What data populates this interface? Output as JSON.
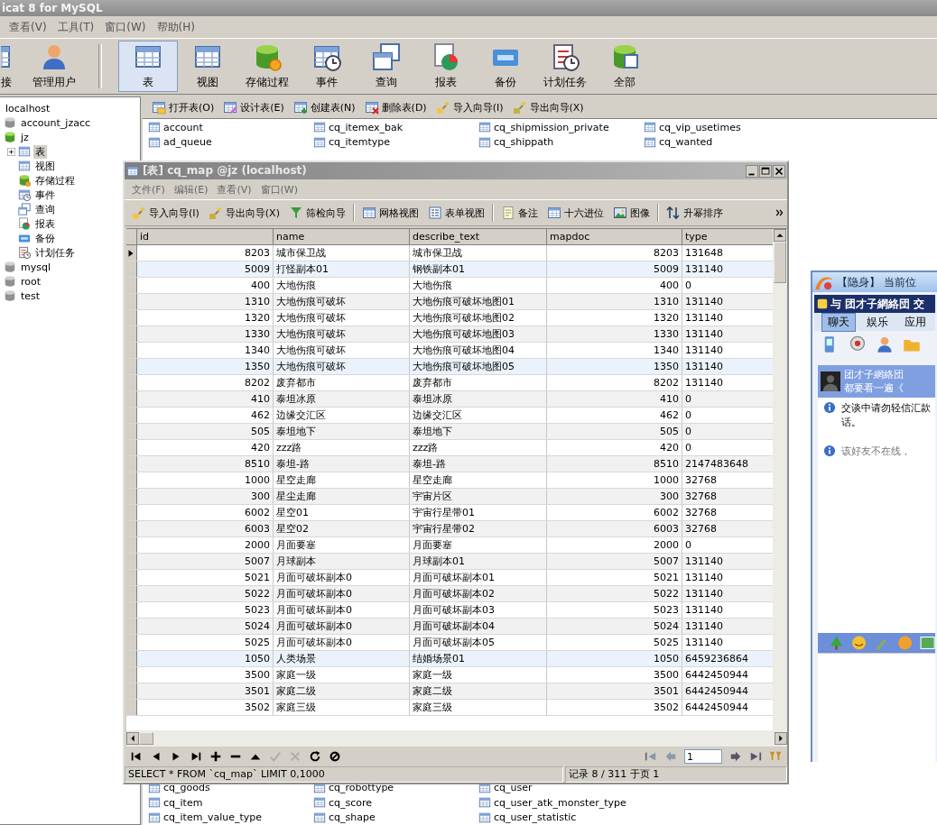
{
  "main_window": {
    "title": "icat 8 for MySQL",
    "menu": [
      "查看(V)",
      "工具(T)",
      "窗口(W)",
      "帮助(H)"
    ],
    "toolbar": [
      {
        "label": "接",
        "selected": false
      },
      {
        "label": "管理用户",
        "selected": false
      },
      {
        "label": "表",
        "selected": true
      },
      {
        "label": "视图",
        "selected": false
      },
      {
        "label": "存储过程",
        "selected": false
      },
      {
        "label": "事件",
        "selected": false
      },
      {
        "label": "查询",
        "selected": false
      },
      {
        "label": "报表",
        "selected": false
      },
      {
        "label": "备份",
        "selected": false
      },
      {
        "label": "计划任务",
        "selected": false
      },
      {
        "label": "全部",
        "selected": false
      }
    ],
    "tree": [
      {
        "label": "localhost",
        "selected": false,
        "children": [
          {
            "label": "account_jzacc",
            "kind": "database",
            "open": false,
            "selected": false
          },
          {
            "label": "jz",
            "kind": "database",
            "open": true,
            "selected": false,
            "children": [
              {
                "label": "表",
                "kind": "table",
                "expanded": false,
                "selected": true
              },
              {
                "label": "视图",
                "kind": "view",
                "selected": false
              },
              {
                "label": "存储过程",
                "kind": "procedure",
                "selected": false
              },
              {
                "label": "事件",
                "kind": "event",
                "selected": false
              },
              {
                "label": "查询",
                "kind": "query",
                "selected": false
              },
              {
                "label": "报表",
                "kind": "report",
                "selected": false
              },
              {
                "label": "备份",
                "kind": "backup",
                "selected": false
              },
              {
                "label": "计划任务",
                "kind": "schedule",
                "selected": false
              }
            ]
          },
          {
            "label": "mysql",
            "kind": "database",
            "open": false,
            "selected": false
          },
          {
            "label": "root",
            "kind": "database",
            "open": false,
            "selected": false
          },
          {
            "label": "test",
            "kind": "database",
            "open": false,
            "selected": false
          }
        ]
      }
    ],
    "object_toolbar": [
      "打开表(O)",
      "设计表(E)",
      "创建表(N)",
      "删除表(D)",
      "导入向导(I)",
      "导出向导(X)"
    ],
    "table_list": {
      "rows_above": [
        [
          "account",
          "cq_itemex_bak",
          "cq_shipmission_private",
          "cq_vip_usetimes"
        ],
        [
          "ad_queue",
          "cq_itemtype",
          "cq_shippath",
          "cq_wanted"
        ]
      ],
      "rows_below": [
        [
          "cq_goods",
          "cq_robottype",
          "cq_user"
        ],
        [
          "cq_item",
          "cq_score",
          "cq_user_atk_monster_type"
        ],
        [
          "cq_item_value_type",
          "cq_shape",
          "cq_user_statistic"
        ]
      ]
    }
  },
  "table_window": {
    "title": "[表] cq_map @jz (localhost)",
    "menu": [
      "文件(F)",
      "编辑(E)",
      "查看(V)",
      "窗口(W)"
    ],
    "toolbar_groups": [
      [
        "导入向导(I)",
        "导出向导(X)",
        "筛检向导"
      ],
      [
        "网格视图",
        "表单视图"
      ],
      [
        "备注",
        "十六进位",
        "图像"
      ],
      [
        "升幂排序"
      ]
    ],
    "columns": [
      "id",
      "name",
      "describe_text",
      "mapdoc",
      "type"
    ],
    "rows": [
      {
        "cells": [
          "8203",
          "城市保卫战",
          "城市保卫战",
          "8203",
          "131648"
        ],
        "current": true,
        "selected": false
      },
      {
        "cells": [
          "5009",
          "打怪副本01",
          "钢铁副本01",
          "5009",
          "131140"
        ],
        "current": false,
        "selected": true
      },
      {
        "cells": [
          "400",
          "大地伤痕",
          "大地伤痕",
          "400",
          "0"
        ],
        "current": false,
        "selected": false
      },
      {
        "cells": [
          "1310",
          "大地伤痕可破坏",
          "大地伤痕可破坏地图01",
          "1310",
          "131140"
        ],
        "current": false,
        "selected": false
      },
      {
        "cells": [
          "1320",
          "大地伤痕可破坏",
          "大地伤痕可破坏地图02",
          "1320",
          "131140"
        ],
        "current": false,
        "selected": false
      },
      {
        "cells": [
          "1330",
          "大地伤痕可破坏",
          "大地伤痕可破坏地图03",
          "1330",
          "131140"
        ],
        "current": false,
        "selected": false
      },
      {
        "cells": [
          "1340",
          "大地伤痕可破坏",
          "大地伤痕可破坏地图04",
          "1340",
          "131140"
        ],
        "current": false,
        "selected": false
      },
      {
        "cells": [
          "1350",
          "大地伤痕可破坏",
          "大地伤痕可破坏地图05",
          "1350",
          "131140"
        ],
        "current": false,
        "selected": true
      },
      {
        "cells": [
          "8202",
          "废弃都市",
          "废弃都市",
          "8202",
          "131140"
        ],
        "current": false,
        "selected": false
      },
      {
        "cells": [
          "410",
          "泰坦冰原",
          "泰坦冰原",
          "410",
          "0"
        ],
        "current": false,
        "selected": false
      },
      {
        "cells": [
          "462",
          "边缘交汇区",
          "边缘交汇区",
          "462",
          "0"
        ],
        "current": false,
        "selected": false
      },
      {
        "cells": [
          "505",
          "泰坦地下",
          "泰坦地下",
          "505",
          "0"
        ],
        "current": false,
        "selected": false
      },
      {
        "cells": [
          "420",
          "zzz路",
          "zzz路",
          "420",
          "0"
        ],
        "current": false,
        "selected": false
      },
      {
        "cells": [
          "8510",
          "泰坦-路",
          "泰坦-路",
          "8510",
          "2147483648"
        ],
        "current": false,
        "selected": false
      },
      {
        "cells": [
          "1000",
          "星空走廊",
          "星空走廊",
          "1000",
          "32768"
        ],
        "current": false,
        "selected": false
      },
      {
        "cells": [
          "300",
          "星尘走廊",
          "宇宙片区",
          "300",
          "32768"
        ],
        "current": false,
        "selected": false
      },
      {
        "cells": [
          "6002",
          "星空01",
          "宇宙行星带01",
          "6002",
          "32768"
        ],
        "current": false,
        "selected": false
      },
      {
        "cells": [
          "6003",
          "星空02",
          "宇宙行星带02",
          "6003",
          "32768"
        ],
        "current": false,
        "selected": false
      },
      {
        "cells": [
          "2000",
          "月面要塞",
          "月面要塞",
          "2000",
          "0"
        ],
        "current": false,
        "selected": false
      },
      {
        "cells": [
          "5007",
          "月球副本",
          "月球副本01",
          "5007",
          "131140"
        ],
        "current": false,
        "selected": false
      },
      {
        "cells": [
          "5021",
          "月面可破坏副本0",
          "月面可破坏副本01",
          "5021",
          "131140"
        ],
        "current": false,
        "selected": false
      },
      {
        "cells": [
          "5022",
          "月面可破坏副本0",
          "月面可破坏副本02",
          "5022",
          "131140"
        ],
        "current": false,
        "selected": false
      },
      {
        "cells": [
          "5023",
          "月面可破坏副本0",
          "月面可破坏副本03",
          "5023",
          "131140"
        ],
        "current": false,
        "selected": false
      },
      {
        "cells": [
          "5024",
          "月面可破坏副本0",
          "月面可破坏副本04",
          "5024",
          "131140"
        ],
        "current": false,
        "selected": false
      },
      {
        "cells": [
          "5025",
          "月面可破坏副本0",
          "月面可破坏副本05",
          "5025",
          "131140"
        ],
        "current": false,
        "selected": false
      },
      {
        "cells": [
          "1050",
          "人类场景",
          "结婚场景01",
          "1050",
          "6459236864"
        ],
        "current": false,
        "selected": true
      },
      {
        "cells": [
          "3500",
          "家庭一级",
          "家庭一级",
          "3500",
          "6442450944"
        ],
        "current": false,
        "selected": false
      },
      {
        "cells": [
          "3501",
          "家庭二级",
          "家庭二级",
          "3501",
          "6442450944"
        ],
        "current": false,
        "selected": false
      },
      {
        "cells": [
          "3502",
          "家庭三级",
          "家庭三级",
          "3502",
          "6442450944"
        ],
        "current": false,
        "selected": false
      }
    ],
    "page_field": "1",
    "status": {
      "sql": "SELECT * FROM `cq_map` LIMIT 0,1000",
      "records": "记录 8 / 311 于页 1"
    }
  },
  "chat_window": {
    "title": "【隐身】 当前位",
    "conversation_title": "与 团才子網絡団 交",
    "tabs": [
      {
        "label": "聊天",
        "selected": true
      },
      {
        "label": "娱乐",
        "selected": false
      },
      {
        "label": "应用",
        "selected": false
      }
    ],
    "contact": {
      "name": "团才子網絡団",
      "signature": "都要看一遍《"
    },
    "messages": [
      {
        "kind": "notice",
        "lines": [
          "交谈中请勿轻信汇款",
          "话。"
        ]
      },
      {
        "kind": "status",
        "lines": [
          "该好友不在线，"
        ]
      }
    ]
  }
}
